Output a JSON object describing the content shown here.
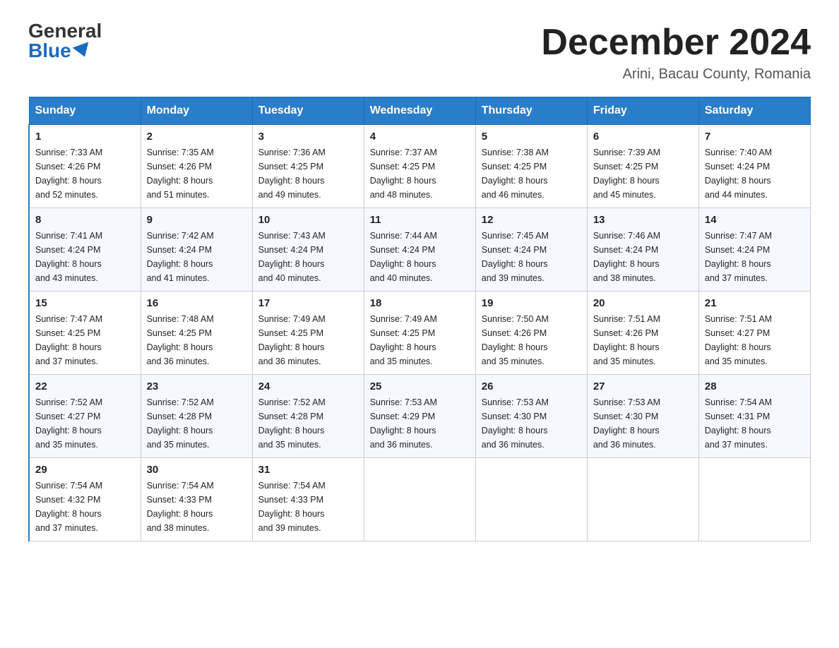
{
  "header": {
    "logo_general": "General",
    "logo_blue": "Blue",
    "month_title": "December 2024",
    "location": "Arini, Bacau County, Romania"
  },
  "days_of_week": [
    "Sunday",
    "Monday",
    "Tuesday",
    "Wednesday",
    "Thursday",
    "Friday",
    "Saturday"
  ],
  "weeks": [
    [
      {
        "num": "1",
        "sunrise": "7:33 AM",
        "sunset": "4:26 PM",
        "daylight": "8 hours and 52 minutes."
      },
      {
        "num": "2",
        "sunrise": "7:35 AM",
        "sunset": "4:26 PM",
        "daylight": "8 hours and 51 minutes."
      },
      {
        "num": "3",
        "sunrise": "7:36 AM",
        "sunset": "4:25 PM",
        "daylight": "8 hours and 49 minutes."
      },
      {
        "num": "4",
        "sunrise": "7:37 AM",
        "sunset": "4:25 PM",
        "daylight": "8 hours and 48 minutes."
      },
      {
        "num": "5",
        "sunrise": "7:38 AM",
        "sunset": "4:25 PM",
        "daylight": "8 hours and 46 minutes."
      },
      {
        "num": "6",
        "sunrise": "7:39 AM",
        "sunset": "4:25 PM",
        "daylight": "8 hours and 45 minutes."
      },
      {
        "num": "7",
        "sunrise": "7:40 AM",
        "sunset": "4:24 PM",
        "daylight": "8 hours and 44 minutes."
      }
    ],
    [
      {
        "num": "8",
        "sunrise": "7:41 AM",
        "sunset": "4:24 PM",
        "daylight": "8 hours and 43 minutes."
      },
      {
        "num": "9",
        "sunrise": "7:42 AM",
        "sunset": "4:24 PM",
        "daylight": "8 hours and 41 minutes."
      },
      {
        "num": "10",
        "sunrise": "7:43 AM",
        "sunset": "4:24 PM",
        "daylight": "8 hours and 40 minutes."
      },
      {
        "num": "11",
        "sunrise": "7:44 AM",
        "sunset": "4:24 PM",
        "daylight": "8 hours and 40 minutes."
      },
      {
        "num": "12",
        "sunrise": "7:45 AM",
        "sunset": "4:24 PM",
        "daylight": "8 hours and 39 minutes."
      },
      {
        "num": "13",
        "sunrise": "7:46 AM",
        "sunset": "4:24 PM",
        "daylight": "8 hours and 38 minutes."
      },
      {
        "num": "14",
        "sunrise": "7:47 AM",
        "sunset": "4:24 PM",
        "daylight": "8 hours and 37 minutes."
      }
    ],
    [
      {
        "num": "15",
        "sunrise": "7:47 AM",
        "sunset": "4:25 PM",
        "daylight": "8 hours and 37 minutes."
      },
      {
        "num": "16",
        "sunrise": "7:48 AM",
        "sunset": "4:25 PM",
        "daylight": "8 hours and 36 minutes."
      },
      {
        "num": "17",
        "sunrise": "7:49 AM",
        "sunset": "4:25 PM",
        "daylight": "8 hours and 36 minutes."
      },
      {
        "num": "18",
        "sunrise": "7:49 AM",
        "sunset": "4:25 PM",
        "daylight": "8 hours and 35 minutes."
      },
      {
        "num": "19",
        "sunrise": "7:50 AM",
        "sunset": "4:26 PM",
        "daylight": "8 hours and 35 minutes."
      },
      {
        "num": "20",
        "sunrise": "7:51 AM",
        "sunset": "4:26 PM",
        "daylight": "8 hours and 35 minutes."
      },
      {
        "num": "21",
        "sunrise": "7:51 AM",
        "sunset": "4:27 PM",
        "daylight": "8 hours and 35 minutes."
      }
    ],
    [
      {
        "num": "22",
        "sunrise": "7:52 AM",
        "sunset": "4:27 PM",
        "daylight": "8 hours and 35 minutes."
      },
      {
        "num": "23",
        "sunrise": "7:52 AM",
        "sunset": "4:28 PM",
        "daylight": "8 hours and 35 minutes."
      },
      {
        "num": "24",
        "sunrise": "7:52 AM",
        "sunset": "4:28 PM",
        "daylight": "8 hours and 35 minutes."
      },
      {
        "num": "25",
        "sunrise": "7:53 AM",
        "sunset": "4:29 PM",
        "daylight": "8 hours and 36 minutes."
      },
      {
        "num": "26",
        "sunrise": "7:53 AM",
        "sunset": "4:30 PM",
        "daylight": "8 hours and 36 minutes."
      },
      {
        "num": "27",
        "sunrise": "7:53 AM",
        "sunset": "4:30 PM",
        "daylight": "8 hours and 36 minutes."
      },
      {
        "num": "28",
        "sunrise": "7:54 AM",
        "sunset": "4:31 PM",
        "daylight": "8 hours and 37 minutes."
      }
    ],
    [
      {
        "num": "29",
        "sunrise": "7:54 AM",
        "sunset": "4:32 PM",
        "daylight": "8 hours and 37 minutes."
      },
      {
        "num": "30",
        "sunrise": "7:54 AM",
        "sunset": "4:33 PM",
        "daylight": "8 hours and 38 minutes."
      },
      {
        "num": "31",
        "sunrise": "7:54 AM",
        "sunset": "4:33 PM",
        "daylight": "8 hours and 39 minutes."
      },
      null,
      null,
      null,
      null
    ]
  ],
  "labels": {
    "sunrise": "Sunrise:",
    "sunset": "Sunset:",
    "daylight": "Daylight:"
  }
}
